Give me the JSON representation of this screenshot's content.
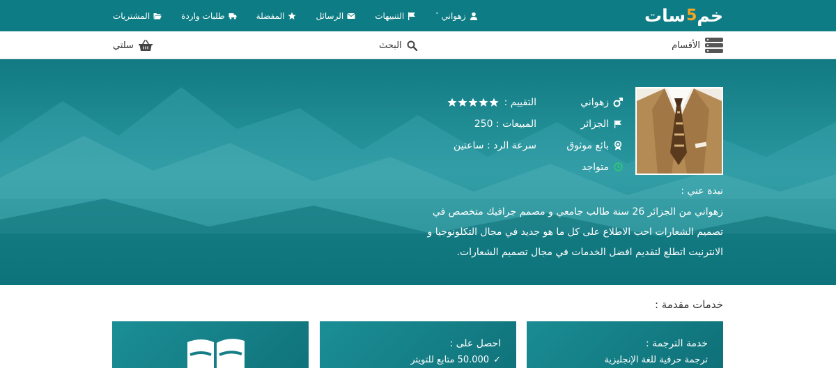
{
  "brand": {
    "logo_text_start": "خم",
    "logo_five": "5",
    "logo_text_end": "سات"
  },
  "topnav": {
    "items": [
      {
        "label": "زهواني",
        "icon": "user-icon",
        "has_caret": true
      },
      {
        "label": "التنبيهات",
        "icon": "flag-icon"
      },
      {
        "label": "الرسائل",
        "icon": "envelope-icon"
      },
      {
        "label": "المفضلة",
        "icon": "star-icon",
        "has_caret": true
      },
      {
        "label": "طلبات واردة",
        "icon": "truck-icon"
      },
      {
        "label": "المشتريات",
        "icon": "folder-open-icon"
      }
    ],
    "caret": "˅"
  },
  "subbar": {
    "categories_label": "الأقسام",
    "search_label": "البحث",
    "cart_label": "سلتي"
  },
  "profile": {
    "name": "زهواني",
    "country": "الجزائر",
    "badge": "بائع موثوق",
    "status": "متواجد",
    "rating_label": "التقييم :",
    "rating_stars": 5,
    "sales_label": "المبيعات : 250",
    "response_label": "سرعة الرد : ساعتين",
    "bio_title": "نبدة عني :",
    "bio_text": "زهواني من الجزائر 26 سنة طالب جامعي و مصمم جرافيك متخصص في تصميم الشعارات احب الاطلاع على كل ما هو جديد في مجال التكلونوجيا و الانترنيت اتطلع لتقديم افضل الخدمات في مجال تصميم الشعارات."
  },
  "services": {
    "title": "خدمات مقدمة :",
    "cards": [
      {
        "title": "خدمة الترجمة :",
        "line": "ترجمة حرفية للغة الإنجليزية"
      },
      {
        "title": "احصل على :",
        "line": "50.000 متابع للتويتر",
        "check": "✓"
      },
      {
        "title": "",
        "line": ""
      }
    ]
  },
  "colors": {
    "primary": "#0e7c84",
    "hero": "#1b8a92",
    "accent": "#f5a623",
    "online": "#2ecc71"
  }
}
